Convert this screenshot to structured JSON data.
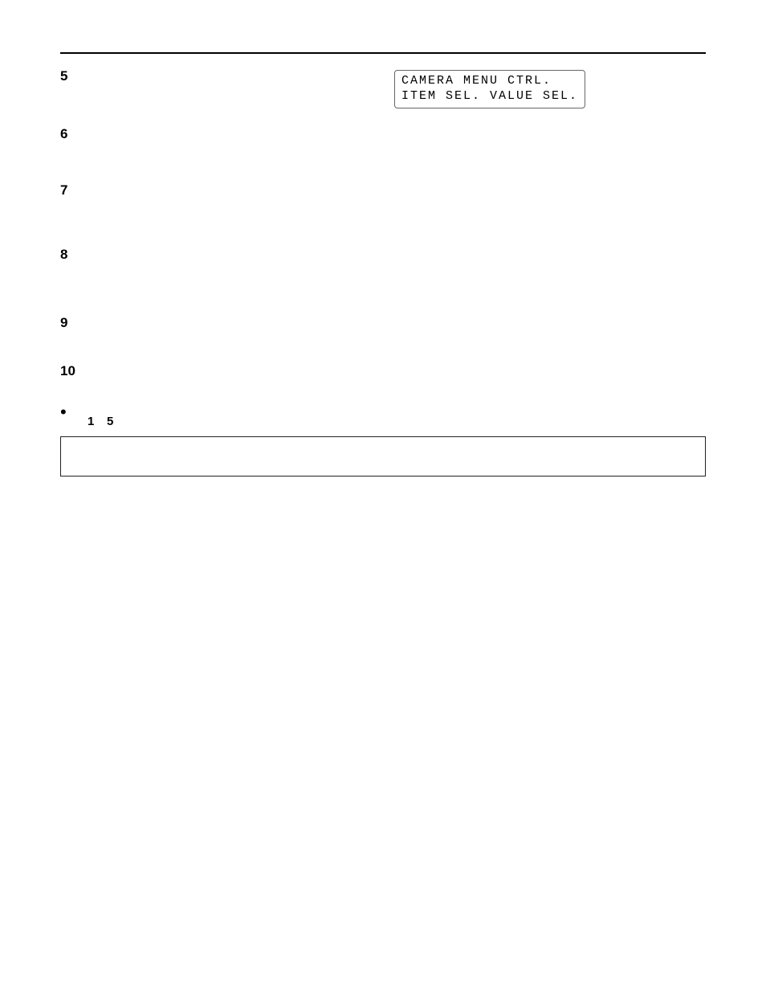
{
  "display": {
    "line1": "CAMERA MENU CTRL.",
    "line2": "ITEM SEL. VALUE SEL."
  },
  "steps": {
    "s5": {
      "num": "5",
      "left_text": ""
    },
    "s6": {
      "num": "6",
      "text": ""
    },
    "s7": {
      "num": "7",
      "text": ""
    },
    "s8": {
      "num": "8",
      "text": ""
    },
    "s9": {
      "num": "9",
      "text": ""
    },
    "s10": {
      "num": "10",
      "text": ""
    }
  },
  "bullet_text_parts": {
    "prefix": "",
    "n1": "1",
    "mid": "",
    "n5": "5",
    "suffix": ""
  },
  "note_text": ""
}
